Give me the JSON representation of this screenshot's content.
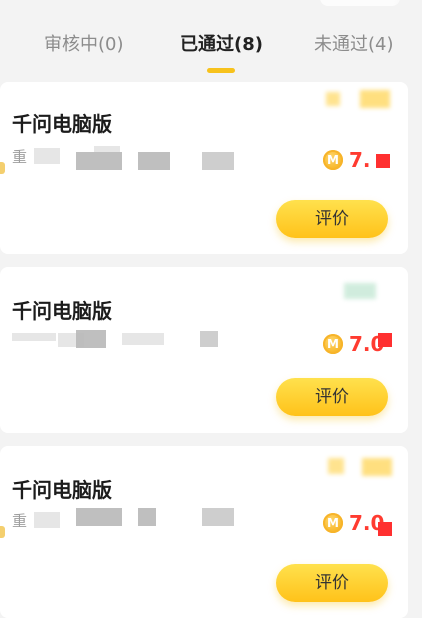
{
  "tabs": [
    {
      "label": "审核中(0)",
      "active": false
    },
    {
      "label": "已通过(8)",
      "active": true
    },
    {
      "label": "未通过(4)",
      "active": false
    }
  ],
  "cards": [
    {
      "title": "千问电脑版",
      "subtitle_prefix": "重",
      "coin_icon": "coin-icon",
      "coin_letter": "M",
      "amount": "7.",
      "button": "评价"
    },
    {
      "title": "千问电脑版",
      "subtitle_prefix": "",
      "coin_icon": "coin-icon",
      "coin_letter": "M",
      "amount": "7.0",
      "button": "评价"
    },
    {
      "title": "千问电脑版",
      "subtitle_prefix": "重",
      "coin_icon": "coin-icon",
      "coin_letter": "M",
      "amount": "7.0",
      "button": "评价"
    }
  ],
  "colors": {
    "accent_yellow": "#f7c21c",
    "amount_red": "#ff3b30",
    "background": "#f3f3f3",
    "card": "#ffffff"
  }
}
